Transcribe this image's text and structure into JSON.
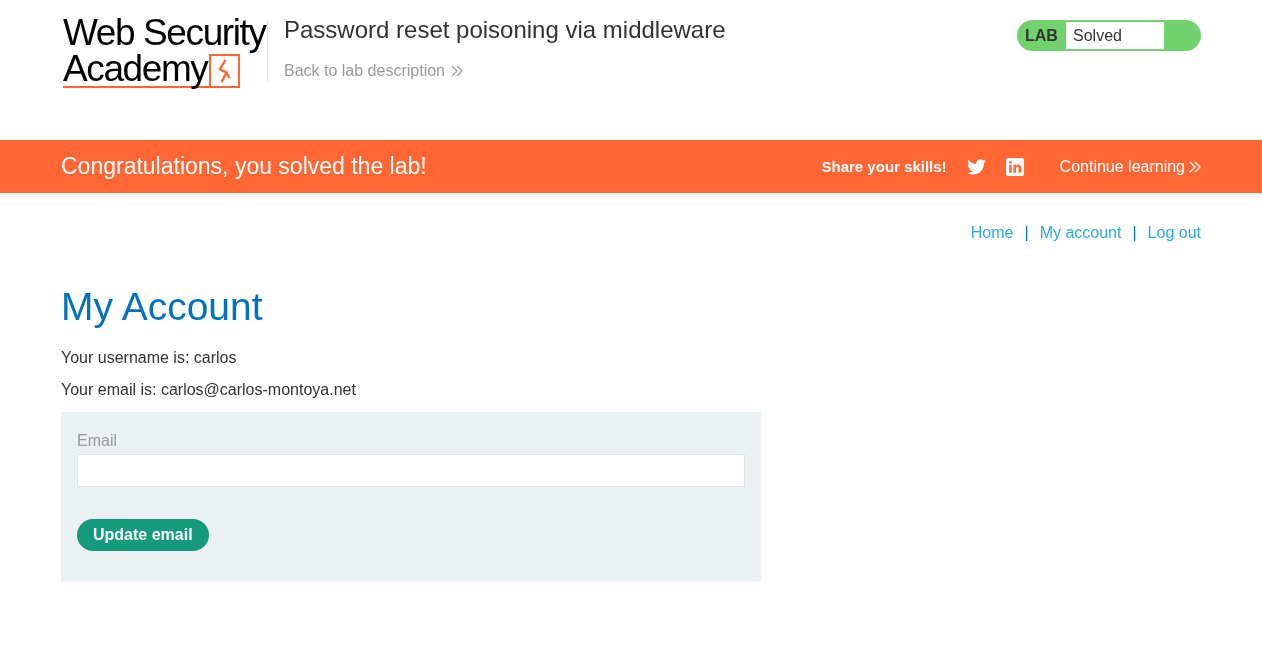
{
  "header": {
    "logo": {
      "lines": [
        "Web Security",
        "Academy"
      ]
    },
    "lab_title": "Password reset poisoning via middleware",
    "back_link": "Back to lab description",
    "lab_status": {
      "label": "LAB",
      "status": "Solved",
      "solved": true
    }
  },
  "banner": {
    "message": "Congratulations, you solved the lab!",
    "share_label": "Share your skills!",
    "continue_link": "Continue learning"
  },
  "nav": [
    {
      "kind": "link",
      "label": "Home"
    },
    {
      "kind": "separator",
      "label": "|"
    },
    {
      "kind": "link",
      "label": "My account"
    },
    {
      "kind": "separator",
      "label": "|"
    },
    {
      "kind": "link",
      "label": "Log out"
    }
  ],
  "page": {
    "heading": "My Account",
    "details": [
      "Your username is: carlos",
      "Your email is: carlos@carlos-montoya.net"
    ]
  },
  "form": {
    "field_label": "Email",
    "button": "Update email"
  }
}
